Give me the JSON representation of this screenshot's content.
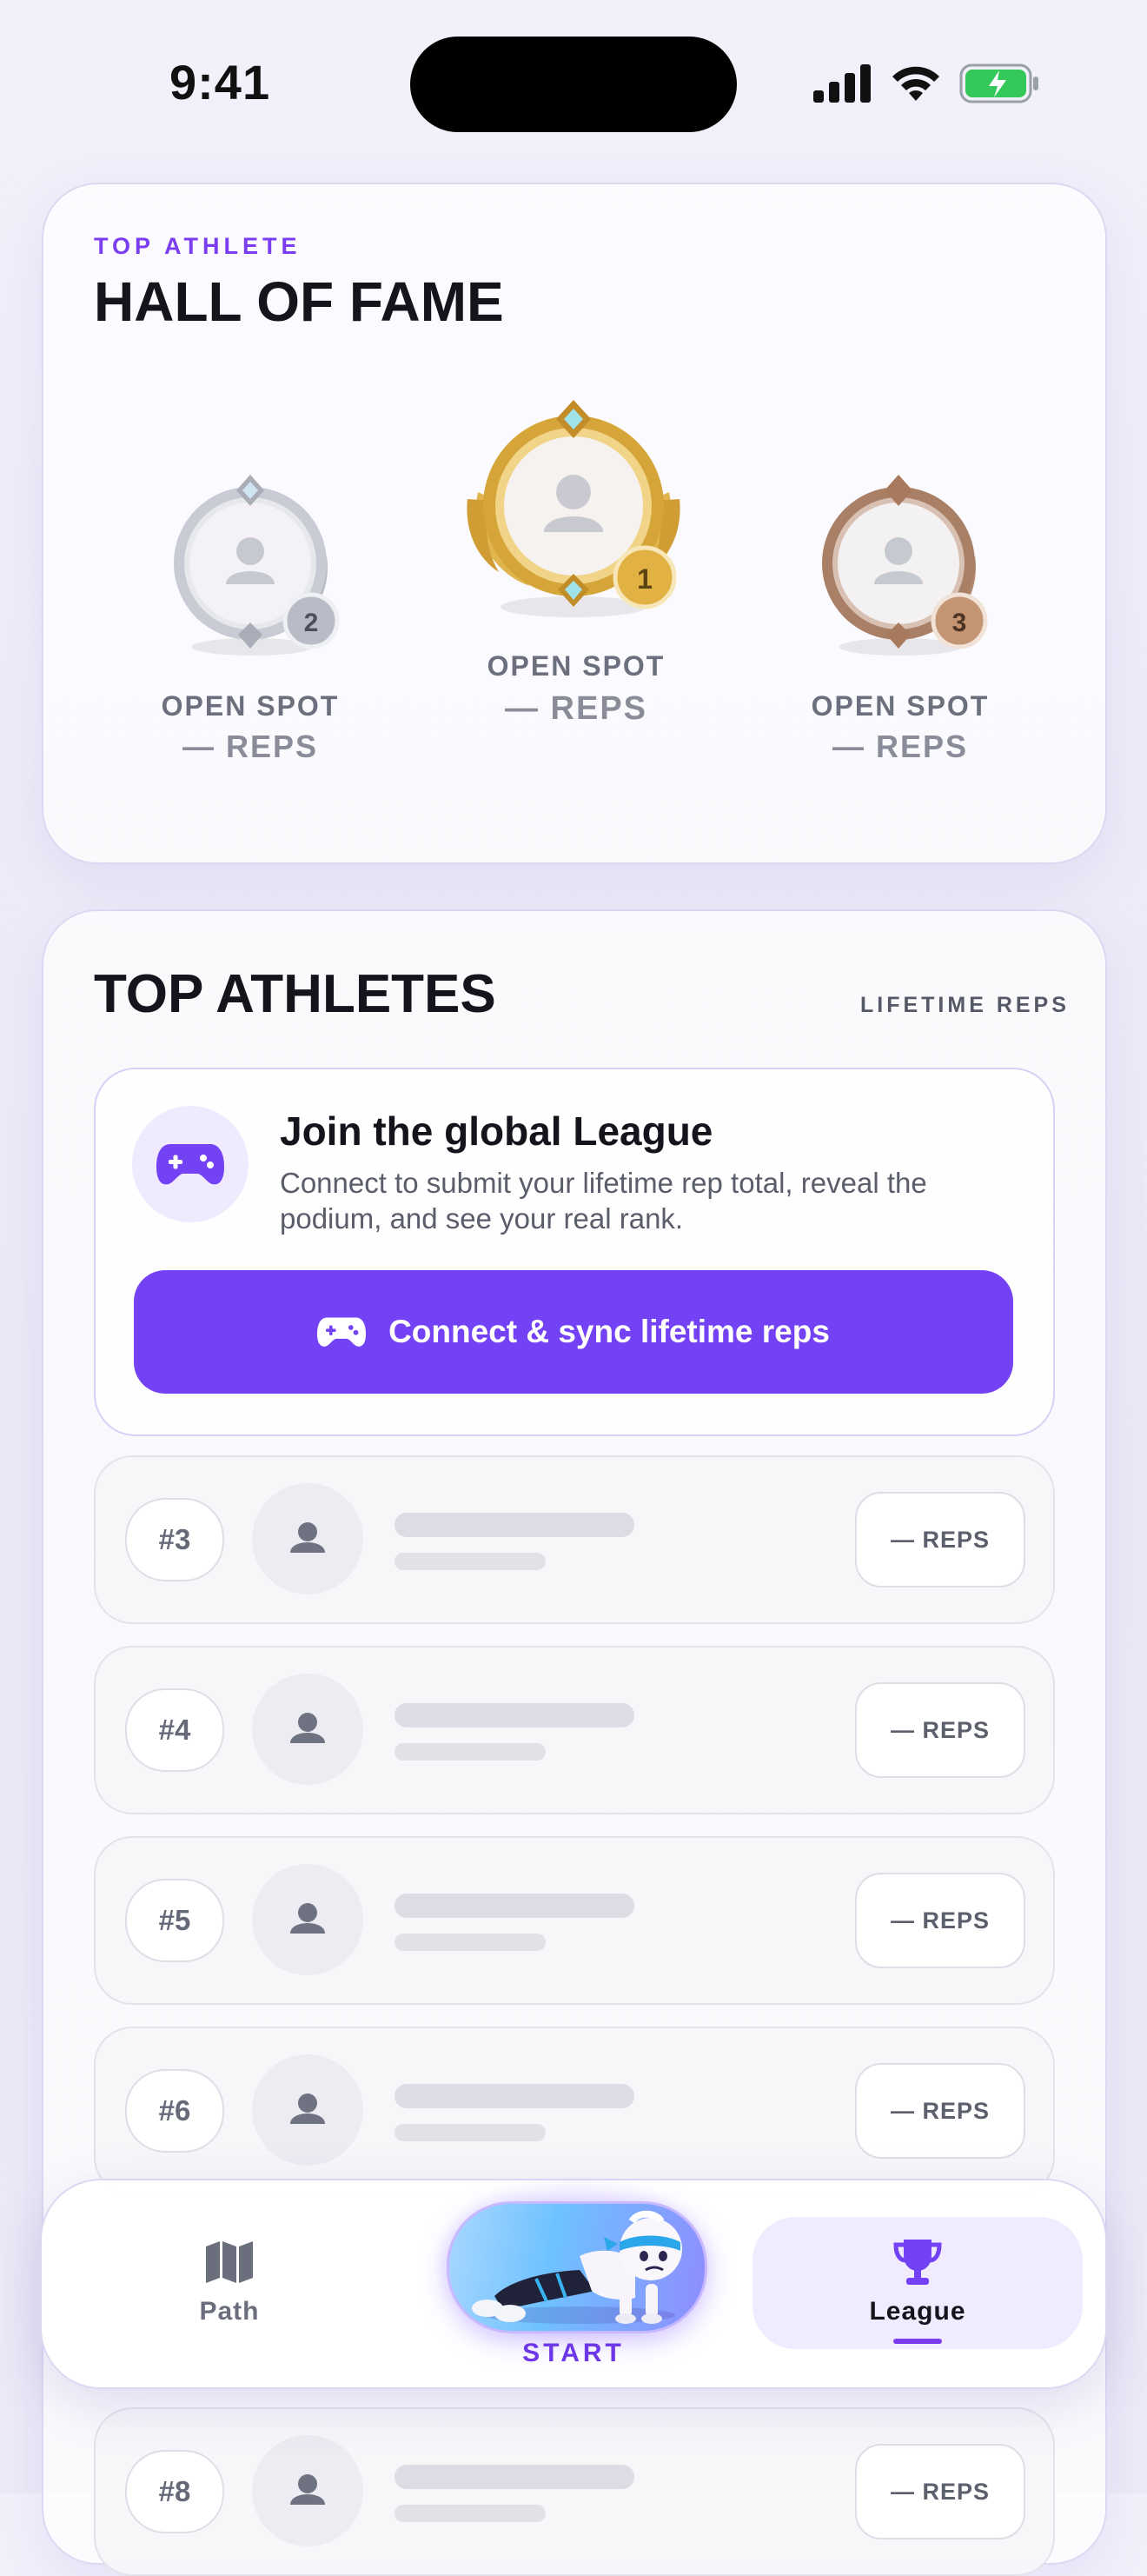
{
  "status_bar": {
    "time": "9:41"
  },
  "hall_of_fame": {
    "eyebrow": "TOP ATHLETE",
    "title": "HALL OF FAME",
    "podium": [
      {
        "rank": "2",
        "name": "OPEN SPOT",
        "reps": "— REPS",
        "tier": "silver",
        "color": "#a9acb8"
      },
      {
        "rank": "1",
        "name": "OPEN SPOT",
        "reps": "— REPS",
        "tier": "gold",
        "color": "#d8a93a"
      },
      {
        "rank": "3",
        "name": "OPEN SPOT",
        "reps": "— REPS",
        "tier": "bronze",
        "color": "#a57a60"
      }
    ]
  },
  "top_athletes": {
    "title": "TOP ATHLETES",
    "subtitle": "LIFETIME REPS",
    "join": {
      "icon": "gamepad-icon",
      "title": "Join the global League",
      "description": "Connect to submit your lifetime rep total, reveal the podium, and see your real rank.",
      "button_label": "Connect & sync lifetime reps"
    },
    "rows": [
      {
        "rank": "#3",
        "reps": "— REPS"
      },
      {
        "rank": "#4",
        "reps": "— REPS"
      },
      {
        "rank": "#5",
        "reps": "— REPS"
      },
      {
        "rank": "#6",
        "reps": "— REPS"
      },
      {
        "rank": "#8",
        "reps": "— REPS"
      }
    ]
  },
  "tab_bar": {
    "path_label": "Path",
    "start_label": "START",
    "league_label": "League",
    "active_tab": "League"
  },
  "colors": {
    "accent": "#7442f5",
    "accent_text": "#7b3df0",
    "battery": "#34c759"
  }
}
